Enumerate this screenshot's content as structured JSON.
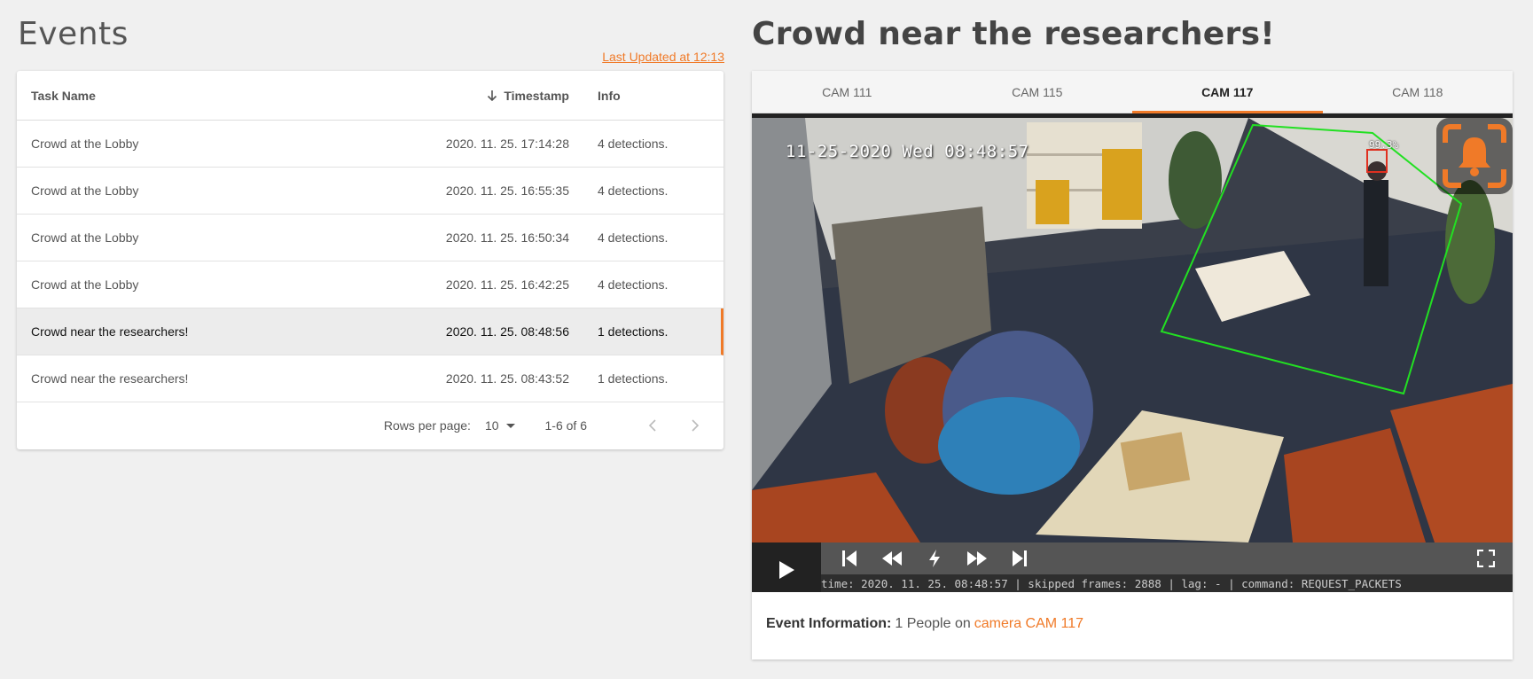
{
  "left": {
    "title": "Events",
    "last_updated": "Last Updated at 12:13",
    "table": {
      "headers": {
        "task_name": "Task Name",
        "timestamp": "Timestamp",
        "info": "Info"
      },
      "rows": [
        {
          "name": "Crowd at the Lobby",
          "time": "2020. 11. 25. 17:14:28",
          "info": "4 detections."
        },
        {
          "name": "Crowd at the Lobby",
          "time": "2020. 11. 25. 16:55:35",
          "info": "4 detections."
        },
        {
          "name": "Crowd at the Lobby",
          "time": "2020. 11. 25. 16:50:34",
          "info": "4 detections."
        },
        {
          "name": "Crowd at the Lobby",
          "time": "2020. 11. 25. 16:42:25",
          "info": "4 detections."
        },
        {
          "name": "Crowd near the researchers!",
          "time": "2020. 11. 25. 08:48:56",
          "info": "1 detections.",
          "selected": true
        },
        {
          "name": "Crowd near the researchers!",
          "time": "2020. 11. 25. 08:43:52",
          "info": "1 detections."
        }
      ],
      "footer": {
        "rows_per_page_label": "Rows per page:",
        "rows_per_page_value": "10",
        "range": "1-6 of 6"
      }
    }
  },
  "right": {
    "title": "Crowd near the researchers!",
    "tabs": [
      {
        "label": "CAM 111",
        "active": false
      },
      {
        "label": "CAM 115",
        "active": false
      },
      {
        "label": "CAM 117",
        "active": true
      },
      {
        "label": "CAM 118",
        "active": false
      }
    ],
    "video": {
      "overlay_timestamp": "11-25-2020 Wed 08:48:57",
      "confidence": "99.3%",
      "stats": "time: 2020. 11. 25. 08:48:57 | skipped frames: 2888 | lag: - | command: REQUEST_PACKETS"
    },
    "event_info": {
      "label": "Event Information:",
      "text": "1 People on",
      "link": "camera CAM 117"
    }
  },
  "colors": {
    "accent": "#f07a28",
    "detection_zone": "#22e022",
    "detection_box": "#e03020"
  }
}
